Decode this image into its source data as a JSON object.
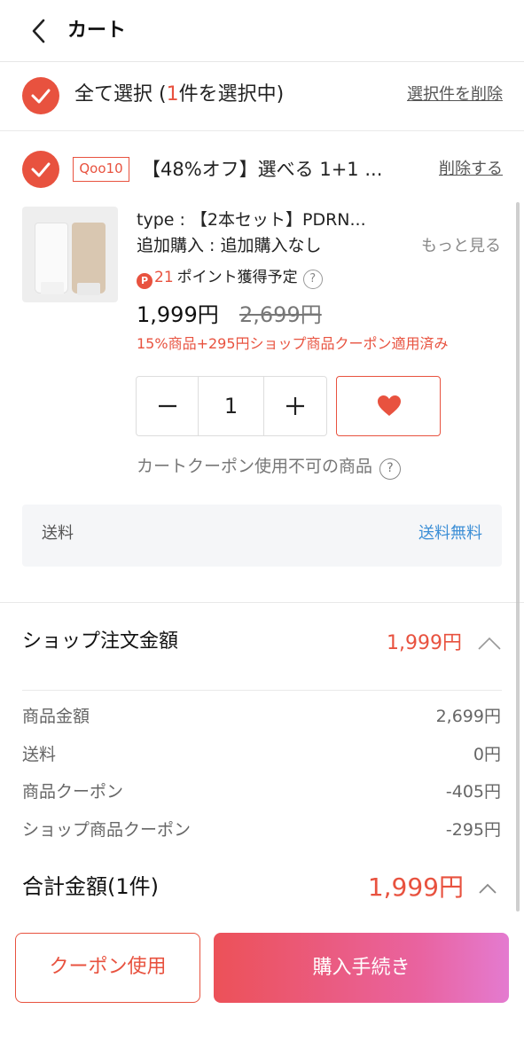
{
  "header": {
    "title": "カート",
    "back_icon": "chevron-left-icon"
  },
  "select_all": {
    "label_prefix": "全て選択 (",
    "count": "1",
    "label_suffix": "件を選択中)",
    "checked": true,
    "delete_selected_label": "選択件を削除"
  },
  "shop": {
    "badge": "Qoo10",
    "product_title": "【48%オフ】選べる 1+1 ...",
    "delete_label": "削除する",
    "checked": true
  },
  "product": {
    "image_icon": "product-tubes-image",
    "option_type": "type : 【2本セット】PDRN...",
    "option_add": "追加購入 : 追加購入なし",
    "more_label": "もっと見る",
    "points_badge": "P",
    "points_value": "21",
    "points_text": "ポイント獲得予定",
    "help_mark": "?",
    "price": "1,999円",
    "original_price": "2,699円",
    "coupon_applied": "15%商品+295円ショップ商品クーポン適用済み",
    "quantity": "1",
    "minus_symbol": "−",
    "plus_symbol": "+",
    "wishlist_icon": "heart-icon",
    "cart_coupon_note": "カートクーポン使用不可の商品"
  },
  "shipping": {
    "label": "送料",
    "value": "送料無料"
  },
  "shop_total": {
    "label": "ショップ注文金額",
    "value": "1,999円"
  },
  "breakdown": [
    {
      "label": "商品金額",
      "value": "2,699円"
    },
    {
      "label": "送料",
      "value": "0円"
    },
    {
      "label": "商品クーポン",
      "value": "-405円"
    },
    {
      "label": "ショップ商品クーポン",
      "value": "-295円"
    }
  ],
  "grand_total": {
    "label": "合計金額(1件)",
    "value": "1,999円"
  },
  "actions": {
    "coupon_label": "クーポン使用",
    "buy_label": "購入手続き"
  },
  "colors": {
    "accent": "#e8523f",
    "link_blue": "#3d8fd6",
    "buy_gradient_start": "#ec5158",
    "buy_gradient_end": "#e47bd0"
  }
}
